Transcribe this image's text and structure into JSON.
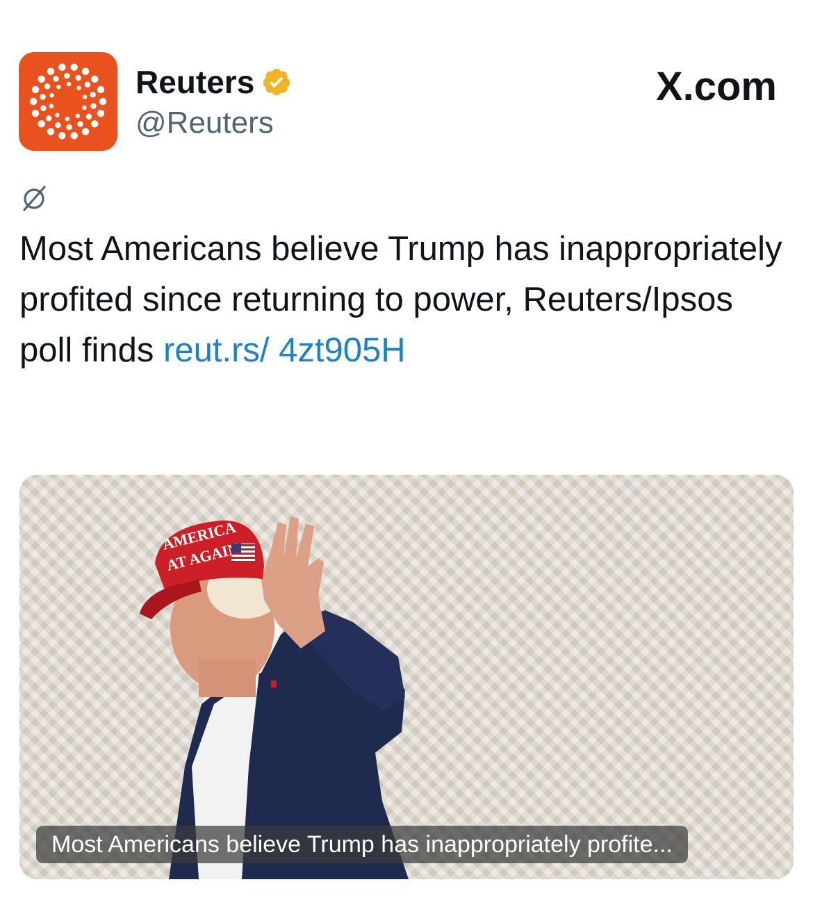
{
  "account": {
    "name": "Reuters",
    "handle": "@Reuters",
    "verified": true,
    "avatar_color": "#e9521f",
    "verified_color": "#f0b429"
  },
  "brand": {
    "label": "X.com"
  },
  "tweet": {
    "translate_icon": "translate-icon",
    "text": "Most Americans believe Trump has inappropriately profited since returning to power, Reuters/Ipsos poll finds ",
    "link_text": "reut.rs/ 4zt905H",
    "link_color": "#1d81c8"
  },
  "media": {
    "caption": "Most Americans believe Trump has inappropriately profite...",
    "hat_text_line1": "AMERICA",
    "hat_text_line2": "AT AGAIN"
  }
}
